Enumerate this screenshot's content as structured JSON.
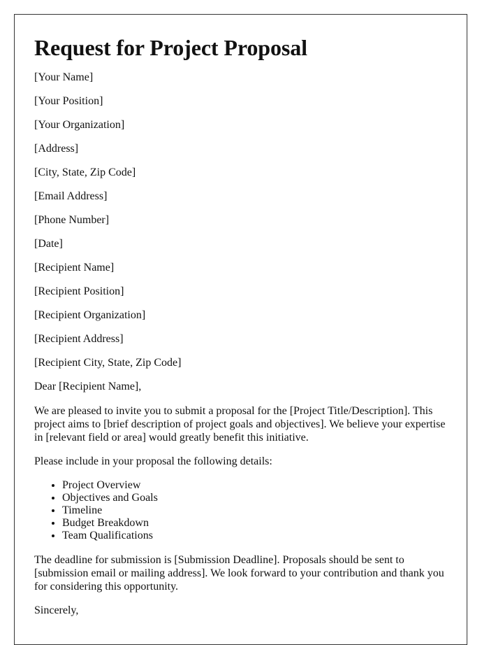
{
  "document": {
    "title": "Request for Project Proposal",
    "sender": [
      "[Your Name]",
      "[Your Position]",
      "[Your Organization]",
      "[Address]",
      "[City, State, Zip Code]",
      "[Email Address]",
      "[Phone Number]"
    ],
    "date": "[Date]",
    "recipient": [
      "[Recipient Name]",
      "[Recipient Position]",
      "[Recipient Organization]",
      "[Recipient Address]",
      "[Recipient City, State, Zip Code]"
    ],
    "salutation": "Dear [Recipient Name],",
    "intro_paragraph": "We are pleased to invite you to submit a proposal for the [Project Title/Description]. This project aims to [brief description of project goals and objectives]. We believe your expertise in [relevant field or area] would greatly benefit this initiative.",
    "details_intro": "Please include in your proposal the following details:",
    "details_list": [
      "Project Overview",
      "Objectives and Goals",
      "Timeline",
      "Budget Breakdown",
      "Team Qualifications"
    ],
    "closing_paragraph": "The deadline for submission is [Submission Deadline]. Proposals should be sent to [submission email or mailing address]. We look forward to your contribution and thank you for considering this opportunity.",
    "signoff": "Sincerely,"
  }
}
